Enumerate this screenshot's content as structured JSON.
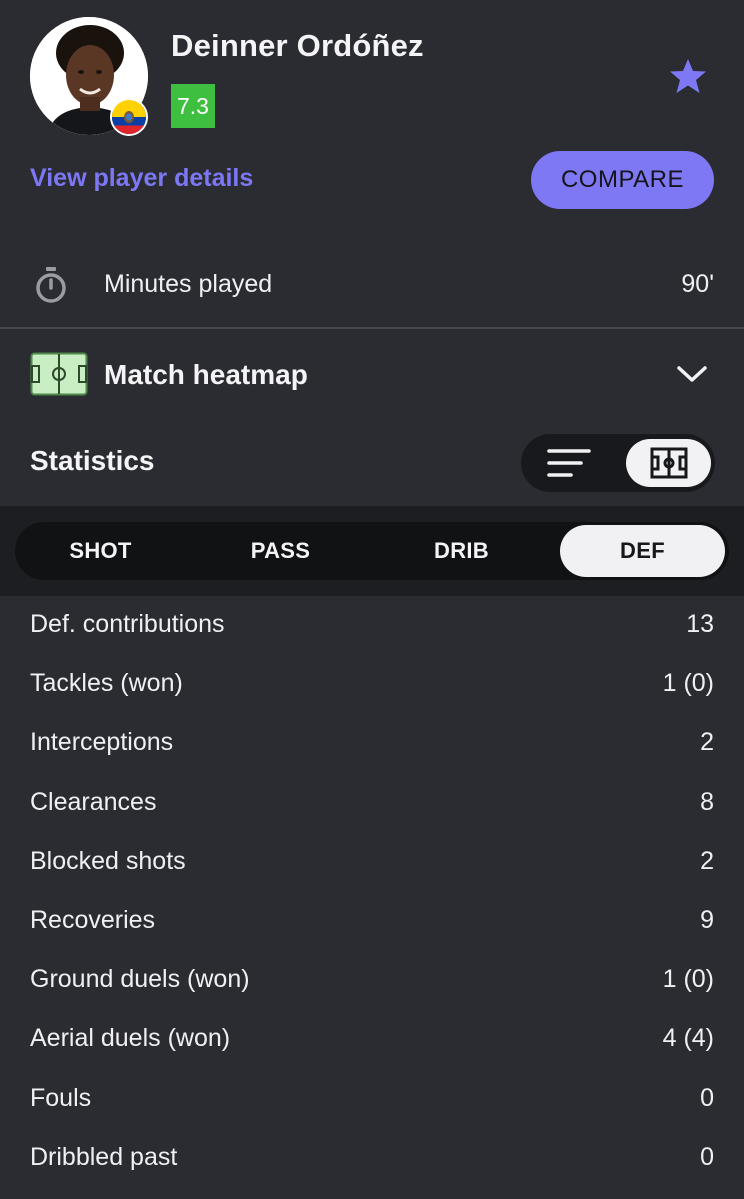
{
  "player": {
    "name": "Deinner Ordóñez",
    "rating": "7.3",
    "rating_color": "#3fbf3f",
    "flag_icon": "ecuador-flag-icon",
    "favorite_icon": "star-icon"
  },
  "actions": {
    "view_details_label": "View player details",
    "compare_label": "COMPARE",
    "accent_color": "#7f78f4"
  },
  "minutes": {
    "icon": "stopwatch-icon",
    "label": "Minutes played",
    "value": "90'"
  },
  "heatmap": {
    "icon": "pitch-icon",
    "label": "Match heatmap",
    "toggle_icon": "chevron-down-icon"
  },
  "statistics": {
    "title": "Statistics",
    "view_toggle": {
      "options": [
        "list-icon",
        "pitch-icon"
      ],
      "selected": "pitch-icon"
    },
    "tabs": [
      {
        "label": "SHOT",
        "selected": false
      },
      {
        "label": "PASS",
        "selected": false
      },
      {
        "label": "DRIB",
        "selected": false
      },
      {
        "label": "DEF",
        "selected": true
      }
    ],
    "rows": [
      {
        "label": "Def. contributions",
        "value": "13"
      },
      {
        "label": "Tackles (won)",
        "value": "1 (0)"
      },
      {
        "label": "Interceptions",
        "value": "2"
      },
      {
        "label": "Clearances",
        "value": "8"
      },
      {
        "label": "Blocked shots",
        "value": "2"
      },
      {
        "label": "Recoveries",
        "value": "9"
      },
      {
        "label": "Ground duels (won)",
        "value": "1 (0)"
      },
      {
        "label": "Aerial duels (won)",
        "value": "4 (4)"
      },
      {
        "label": "Fouls",
        "value": "0"
      },
      {
        "label": "Dribbled past",
        "value": "0"
      }
    ]
  }
}
